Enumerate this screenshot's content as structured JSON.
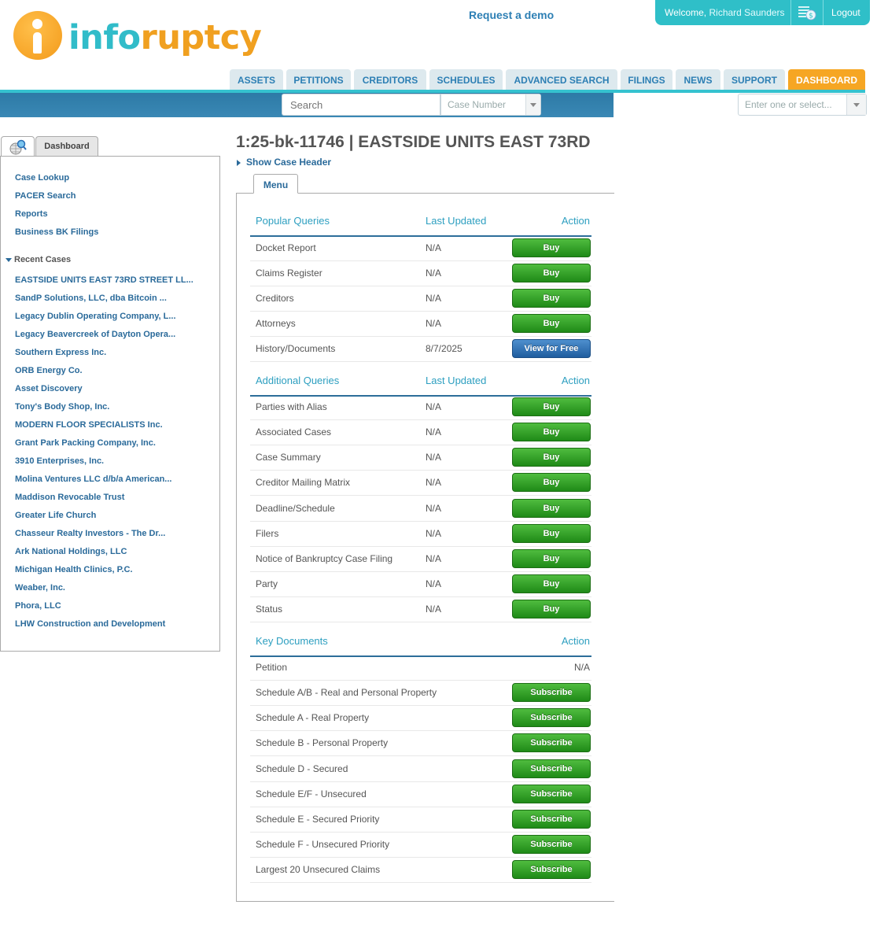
{
  "brand": {
    "part1": "info",
    "part2": "ruptcy"
  },
  "header": {
    "request_demo": "Request a demo",
    "welcome": "Welcome,",
    "user_name": "Richard Saunders",
    "logout": "Logout"
  },
  "nav": {
    "tabs": [
      "ASSETS",
      "PETITIONS",
      "CREDITORS",
      "SCHEDULES",
      "ADVANCED SEARCH",
      "FILINGS",
      "NEWS",
      "SUPPORT",
      "DASHBOARD"
    ],
    "active": "DASHBOARD"
  },
  "search": {
    "placeholder": "Search",
    "type_select": "Case Number",
    "right_select_placeholder": "Enter one or select..."
  },
  "sidebar": {
    "tab_label": "Dashboard",
    "links": [
      "Case Lookup",
      "PACER Search",
      "Reports",
      "Business BK Filings"
    ],
    "recent_header": "Recent Cases",
    "recent_cases": [
      "EASTSIDE UNITS EAST 73RD STREET LL...",
      "SandP Solutions, LLC, dba Bitcoin ...",
      "Legacy Dublin Operating Company, L...",
      "Legacy Beavercreek of Dayton Opera...",
      "Southern Express Inc.",
      "ORB Energy Co.",
      "Asset Discovery",
      "Tony's Body Shop, Inc.",
      "MODERN FLOOR SPECIALISTS Inc.",
      "Grant Park Packing Company, Inc.",
      "3910 Enterprises, Inc.",
      "Molina Ventures LLC d/b/a American...",
      "Maddison Revocable Trust",
      "Greater Life Church",
      "Chasseur Realty Investors - The Dr...",
      "Ark National Holdings, LLC",
      "Michigan Health Clinics, P.C.",
      "Weaber, Inc.",
      "Phora, LLC",
      "LHW Construction and Development"
    ]
  },
  "case": {
    "title": "1:25-bk-11746 | EASTSIDE UNITS EAST 73RD",
    "show_header": "Show Case Header",
    "menu_tab": "Menu"
  },
  "popular": {
    "headers": [
      "Popular Queries",
      "Last Updated",
      "Action"
    ],
    "rows": [
      {
        "name": "Docket Report",
        "updated": "N/A",
        "action": "Buy",
        "style": "green"
      },
      {
        "name": "Claims Register",
        "updated": "N/A",
        "action": "Buy",
        "style": "green"
      },
      {
        "name": "Creditors",
        "updated": "N/A",
        "action": "Buy",
        "style": "green"
      },
      {
        "name": "Attorneys",
        "updated": "N/A",
        "action": "Buy",
        "style": "green"
      },
      {
        "name": "History/Documents",
        "updated": "8/7/2025",
        "action": "View for Free",
        "style": "blue"
      }
    ]
  },
  "additional": {
    "headers": [
      "Additional Queries",
      "Last Updated",
      "Action"
    ],
    "rows": [
      {
        "name": "Parties with Alias",
        "updated": "N/A",
        "action": "Buy"
      },
      {
        "name": "Associated Cases",
        "updated": "N/A",
        "action": "Buy"
      },
      {
        "name": "Case Summary",
        "updated": "N/A",
        "action": "Buy"
      },
      {
        "name": "Creditor Mailing Matrix",
        "updated": "N/A",
        "action": "Buy"
      },
      {
        "name": "Deadline/Schedule",
        "updated": "N/A",
        "action": "Buy"
      },
      {
        "name": "Filers",
        "updated": "N/A",
        "action": "Buy"
      },
      {
        "name": "Notice of Bankruptcy Case Filing",
        "updated": "N/A",
        "action": "Buy"
      },
      {
        "name": "Party",
        "updated": "N/A",
        "action": "Buy"
      },
      {
        "name": "Status",
        "updated": "N/A",
        "action": "Buy"
      }
    ]
  },
  "key_documents": {
    "headers": [
      "Key Documents",
      "Action"
    ],
    "rows": [
      {
        "name": "Petition",
        "action": "N/A"
      },
      {
        "name": "Schedule A/B - Real and Personal Property",
        "action": "Subscribe"
      },
      {
        "name": "Schedule A - Real Property",
        "action": "Subscribe"
      },
      {
        "name": "Schedule B - Personal Property",
        "action": "Subscribe"
      },
      {
        "name": "Schedule D - Secured",
        "action": "Subscribe"
      },
      {
        "name": "Schedule E/F - Unsecured",
        "action": "Subscribe"
      },
      {
        "name": "Schedule E - Secured Priority",
        "action": "Subscribe"
      },
      {
        "name": "Schedule F - Unsecured Priority",
        "action": "Subscribe"
      },
      {
        "name": "Largest 20 Unsecured Claims",
        "action": "Subscribe"
      }
    ]
  },
  "icons": {
    "logo": "info-i-icon",
    "account": "billing-icon",
    "dashboard_tab": "globe-search-icon"
  },
  "colors": {
    "brand_teal": "#2fbfc8",
    "brand_orange": "#f6a623",
    "link_blue": "#2a6a9a",
    "buy_green": "#2e9e24",
    "view_blue": "#2a6fb5"
  }
}
